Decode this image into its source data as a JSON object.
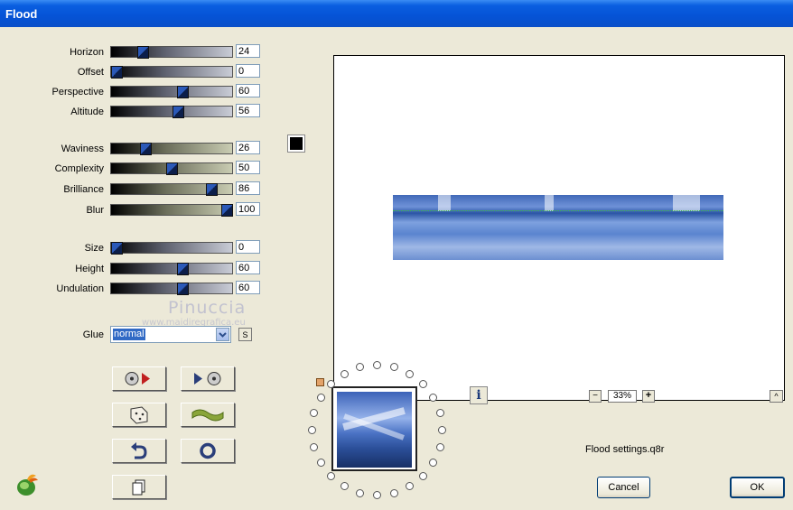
{
  "window": {
    "title": "Flood"
  },
  "sliders": [
    {
      "label": "Horizon",
      "value": "24",
      "level": 0.24,
      "track": "gray"
    },
    {
      "label": "Offset",
      "value": "0",
      "level": 0.0,
      "track": "gray"
    },
    {
      "label": "Perspective",
      "value": "60",
      "level": 0.6,
      "track": "gray"
    },
    {
      "label": "Altitude",
      "value": "56",
      "level": 0.56,
      "track": "gray"
    },
    {
      "label": "Waviness",
      "value": "26",
      "level": 0.26,
      "track": "olive"
    },
    {
      "label": "Complexity",
      "value": "50",
      "level": 0.5,
      "track": "olive"
    },
    {
      "label": "Brilliance",
      "value": "86",
      "level": 0.86,
      "track": "olive"
    },
    {
      "label": "Blur",
      "value": "100",
      "level": 1.0,
      "track": "olive"
    },
    {
      "label": "Size",
      "value": "0",
      "level": 0.0,
      "track": "gray"
    },
    {
      "label": "Height",
      "value": "60",
      "level": 0.6,
      "track": "gray"
    },
    {
      "label": "Undulation",
      "value": "60",
      "level": 0.6,
      "track": "gray"
    }
  ],
  "glue": {
    "label": "Glue",
    "value": "normal",
    "small_button": "S"
  },
  "color_swatch": "#000000",
  "watermark": {
    "name": "Pinuccia",
    "url": "www.maidiregrafica.eu"
  },
  "zoom": {
    "value": "33%",
    "minus": "−",
    "plus": "+",
    "up": "^"
  },
  "info_button": "i",
  "settings_file": "Flood settings.q8r",
  "buttons": {
    "cancel": "Cancel",
    "ok": "OK"
  },
  "icons": {
    "reset": "disc-arrow-icon",
    "play": "arrow-disc-icon",
    "random": "dice-icon",
    "wave": "wave-icon",
    "undo": "undo-arrow-icon",
    "circle": "circle-icon",
    "copy": "copy-pages-icon",
    "logo": "flaming-pear-logo-icon"
  }
}
